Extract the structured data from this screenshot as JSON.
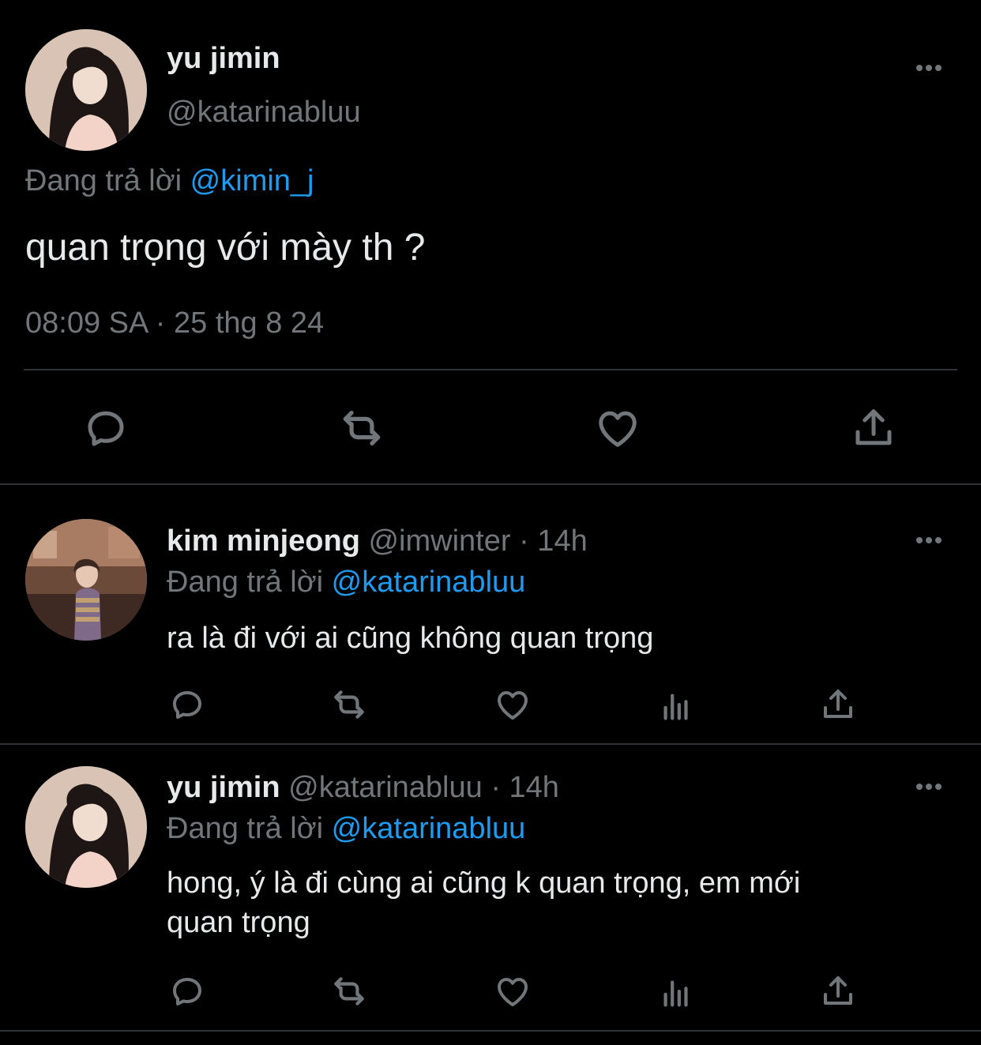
{
  "main_tweet": {
    "author_name": "yu jimin",
    "author_handle": "@katarinabluu",
    "replying_label": "Đang trả lời",
    "replying_to": "@kimin_j",
    "text": "quan trọng với mày th ?",
    "timestamp": "08:09 SA · 25 thg 8 24"
  },
  "replies": [
    {
      "author_name": "kim minjeong",
      "author_handle": "@imwinter",
      "time": "· 14h",
      "replying_label": "Đang trả lời",
      "replying_to": "@katarinabluu",
      "text_lines": [
        "ra là đi với ai cũng không quan trọng"
      ]
    },
    {
      "author_name": "yu jimin",
      "author_handle": "@katarinabluu",
      "time": "· 14h",
      "replying_label": "Đang trả lời",
      "replying_to": "@katarinabluu",
      "text_lines": [
        "hong, ý là đi cùng ai cũng k quan trọng, em mới",
        "quan trọng"
      ]
    }
  ],
  "icons": {
    "reply": "reply-icon",
    "retweet": "retweet-icon",
    "like": "heart-icon",
    "views": "views-icon",
    "share": "share-icon",
    "more": "more-icon"
  },
  "colors": {
    "background": "#000000",
    "text": "#e7e9ea",
    "muted": "#71767b",
    "link": "#1d9bf0",
    "divider": "#2f3336"
  }
}
